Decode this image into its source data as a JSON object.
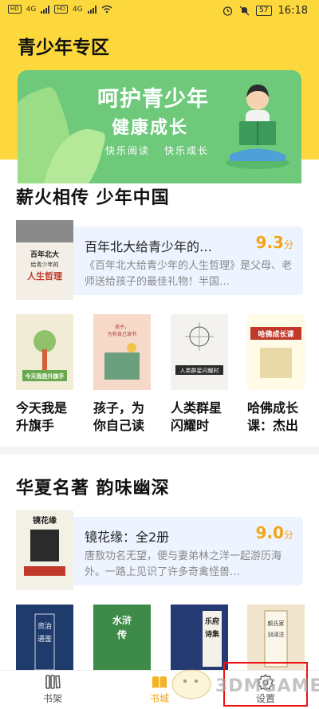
{
  "status_bar": {
    "sim1": "HD",
    "sim2": "HD",
    "net1": "4G",
    "net2": "4G",
    "battery": "57",
    "time": "16:18"
  },
  "page_title": "青少年专区",
  "banner": {
    "title": "呵护青少年",
    "subtitle": "健康成长",
    "tag1": "快乐阅读",
    "tag2": "快乐成长"
  },
  "section1": {
    "title": "薪火相传 少年中国",
    "feature": {
      "name": "百年北大给青少年的…",
      "rating": "9.3",
      "rating_unit": "分",
      "desc": "《百年北大给青少年的人生哲理》是父母、老师送给孩子的最佳礼物！半国…",
      "cover_text": "百年北大给青少年的人生哲理"
    },
    "books": [
      {
        "title": "今天我是升旗手",
        "cover_text": "今天我是升旗手"
      },
      {
        "title": "孩子，为你自己读",
        "cover_text": "孩子,为你自己读书"
      },
      {
        "title": "人类群星闪耀时",
        "cover_text": "人类群星闪耀时"
      },
      {
        "title": "哈佛成长课：杰出",
        "cover_text": "哈佛成长课"
      }
    ]
  },
  "section2": {
    "title": "华夏名著 韵味幽深",
    "feature": {
      "name": "镜花缘：全2册",
      "rating": "9.0",
      "rating_unit": "分",
      "desc": "唐敖功名无望，便与妻弟林之洋一起游历海外。一路上见识了许多奇禽怪兽…",
      "cover_text": "镜花缘"
    },
    "books": [
      {
        "cover_text": "资治通鉴"
      },
      {
        "cover_text": "水浒传"
      },
      {
        "cover_text": "乐府诗集"
      },
      {
        "cover_text": "颜氏家训译注"
      }
    ]
  },
  "nav": {
    "bookshelf": "书架",
    "store": "书城",
    "settings": "设置"
  },
  "watermark": "3DMGAME",
  "colors": {
    "header_bg": "#fcd83d",
    "banner_bg": "#6ec97b",
    "rating": "#f2a51a",
    "highlight": "#e11111"
  }
}
